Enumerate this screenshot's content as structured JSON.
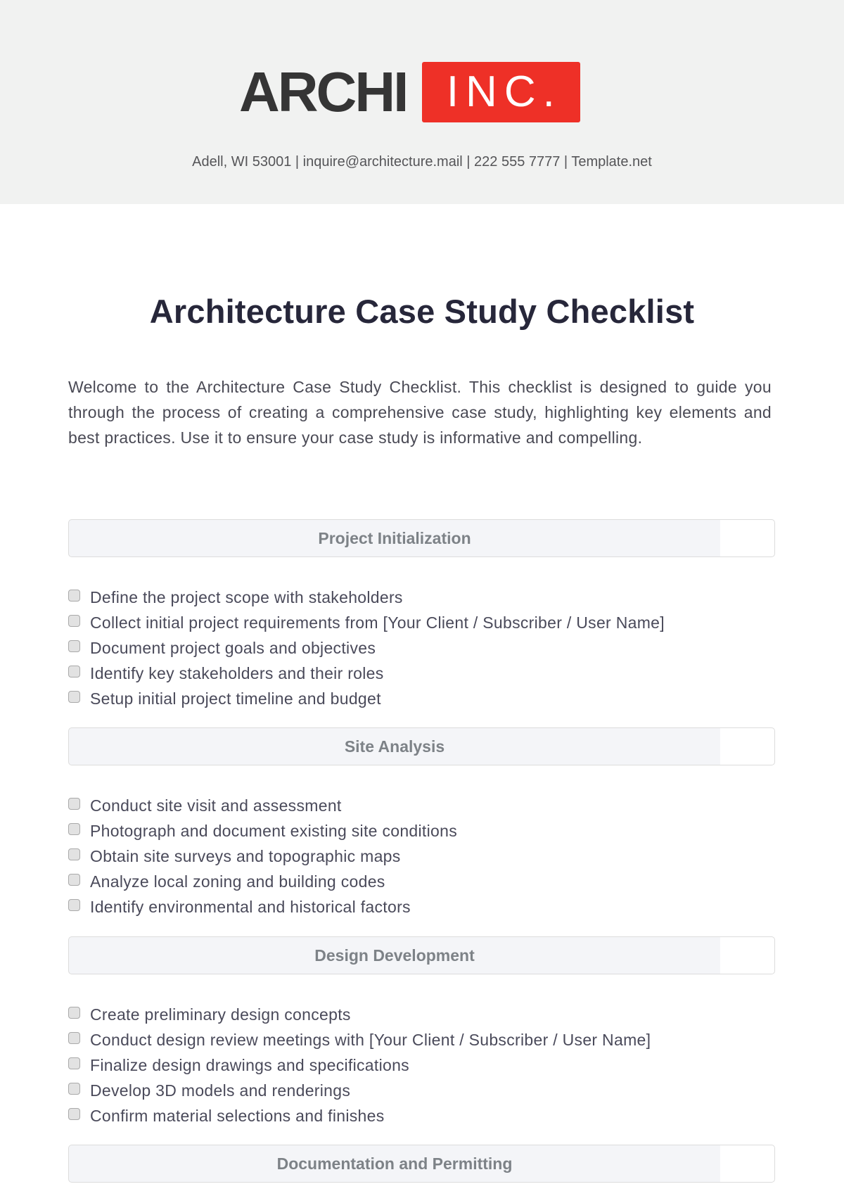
{
  "header": {
    "logo_left": "ARCHI",
    "logo_right": "INC.",
    "contact_line": "Adell, WI 53001 | inquire@architecture.mail | 222 555 7777 | Template.net",
    "brand_color": "#ee3027"
  },
  "title": "Architecture Case Study Checklist",
  "intro": "Welcome to the Architecture Case Study Checklist. This checklist is designed to guide you through the process of creating a comprehensive case study, highlighting key elements and best practices. Use it to ensure your case study is informative and compelling.",
  "sections": [
    {
      "heading": "Project Initialization",
      "items": [
        {
          "label": "Define the project scope with stakeholders",
          "checked": false
        },
        {
          "label": "Collect initial project requirements from [Your Client / Subscriber / User Name]",
          "checked": false
        },
        {
          "label": "Document project goals and objectives",
          "checked": false
        },
        {
          "label": "Identify key stakeholders and their roles",
          "checked": false
        },
        {
          "label": "Setup initial project timeline and budget",
          "checked": false
        }
      ]
    },
    {
      "heading": "Site Analysis",
      "items": [
        {
          "label": "Conduct site visit and assessment",
          "checked": false
        },
        {
          "label": "Photograph and document existing site conditions",
          "checked": false
        },
        {
          "label": "Obtain site surveys and topographic maps",
          "checked": false
        },
        {
          "label": "Analyze local zoning and building codes",
          "checked": false
        },
        {
          "label": "Identify environmental and historical factors",
          "checked": false
        }
      ]
    },
    {
      "heading": "Design Development",
      "items": [
        {
          "label": "Create preliminary design concepts",
          "checked": false
        },
        {
          "label": "Conduct design review meetings with [Your Client / Subscriber / User Name]",
          "checked": false
        },
        {
          "label": "Finalize design drawings and specifications",
          "checked": false
        },
        {
          "label": "Develop 3D models and renderings",
          "checked": false
        },
        {
          "label": "Confirm material selections and finishes",
          "checked": false
        }
      ]
    },
    {
      "heading": "Documentation and Permitting",
      "items": []
    }
  ]
}
